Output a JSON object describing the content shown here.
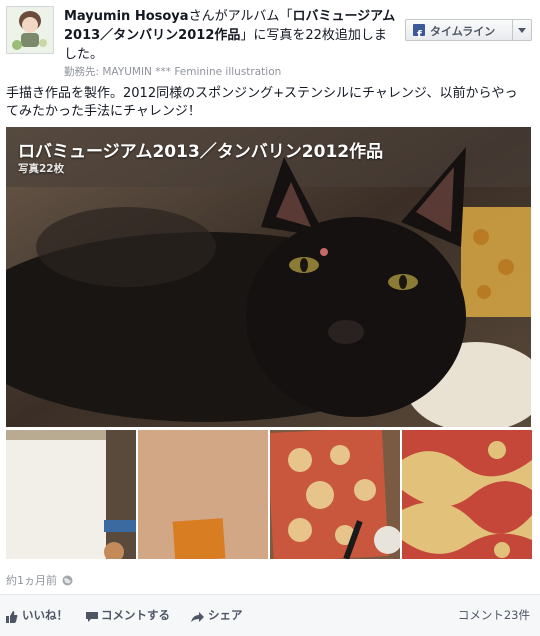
{
  "header": {
    "user_name": "Mayumin Hosoya",
    "text_mid": "さんがアルバム「",
    "album_name": "ロバミュージアム2013／タンバリン2012作品",
    "text_end": "」に写真を22枚追加しました。",
    "workplace": "勤務先: MAYUMIN *** Feminine illustration"
  },
  "timeline_button": {
    "label": "タイムライン"
  },
  "description": "手描き作品を製作。2012同様のスポンジング+ステンシルにチャレンジ、以前からやってみたかった手法にチャレンジ！",
  "album": {
    "title": "ロバミュージアム2013／タンバリン2012作品",
    "count": "写真22枚"
  },
  "meta": {
    "time": "約1ヵ月前"
  },
  "actions": {
    "like": "いいね！",
    "comment": "コメントする",
    "share": "シェア",
    "comment_count": "コメント23件"
  },
  "colors": {
    "fb_blue": "#3b5998",
    "text": "#141823",
    "muted": "#90949c"
  }
}
